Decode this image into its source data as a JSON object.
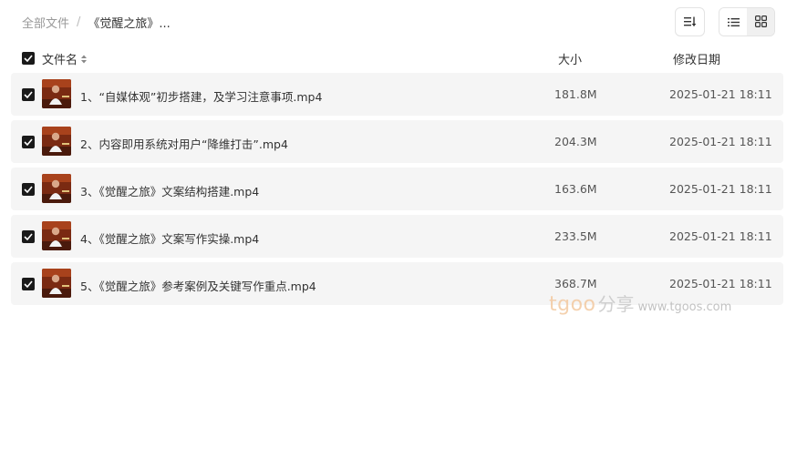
{
  "breadcrumb": {
    "root": "全部文件",
    "separator": "/",
    "current": "《觉醒之旅》..."
  },
  "toolbar": {
    "sort_icon": "sort-icon",
    "list_view_icon": "list-view-icon",
    "grid_view_icon": "grid-view-icon"
  },
  "table": {
    "headers": {
      "name": "文件名",
      "size": "大小",
      "date": "修改日期"
    },
    "rows": [
      {
        "name": "1、“自媒体观”初步搭建，及学习注意事项.mp4",
        "size": "181.8M",
        "date": "2025-01-21 18:11",
        "checked": true
      },
      {
        "name": "2、内容即用系统对用户“降维打击”.mp4",
        "size": "204.3M",
        "date": "2025-01-21 18:11",
        "checked": true
      },
      {
        "name": "3、《觉醒之旅》文案结构搭建.mp4",
        "size": "163.6M",
        "date": "2025-01-21 18:11",
        "checked": true
      },
      {
        "name": "4、《觉醒之旅》文案写作实操.mp4",
        "size": "233.5M",
        "date": "2025-01-21 18:11",
        "checked": true
      },
      {
        "name": "5、《觉醒之旅》参考案例及关键写作重点.mp4",
        "size": "368.7M",
        "date": "2025-01-21 18:11",
        "checked": true
      }
    ]
  },
  "watermark": {
    "brand": "tgoo",
    "cn": "分享",
    "url": "www.tgoos.com"
  },
  "colors": {
    "row_bg": "#f5f5f5",
    "checkbox": "#1a1a1a",
    "watermark_brand": "#f3c9a0"
  }
}
